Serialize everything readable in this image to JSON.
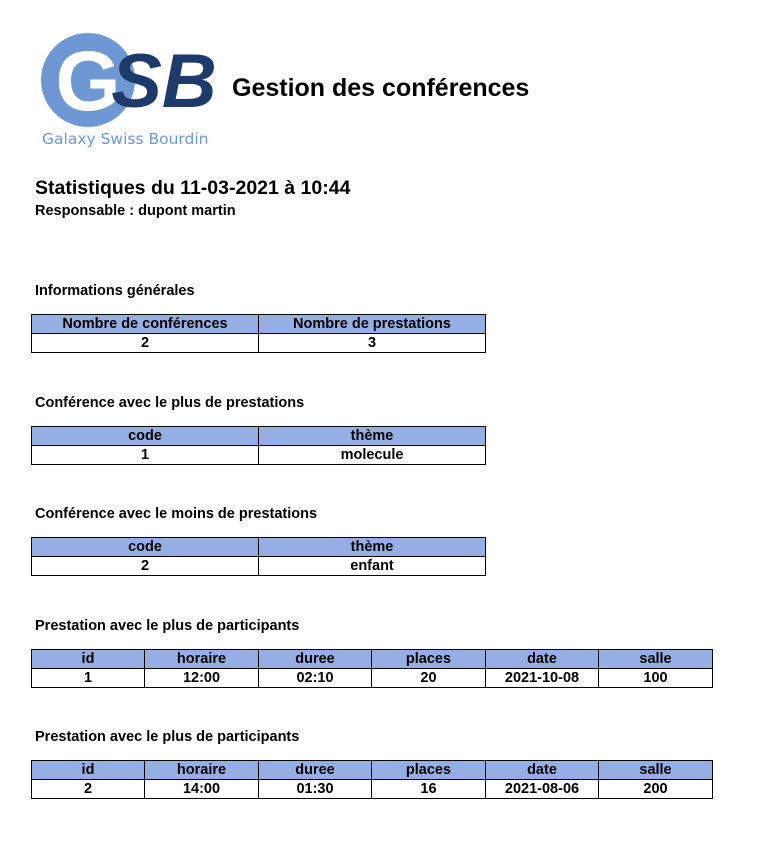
{
  "header": {
    "logo_text": "GSB",
    "logo_subtitle": "Galaxy Swiss Bourdin",
    "app_title": "Gestion des conférences"
  },
  "report": {
    "title": "Statistiques du 11-03-2021 à 10:44",
    "responsable": "Responsable : dupont martin"
  },
  "colors": {
    "header_fill": "#95aee4",
    "logo_light_blue": "#6d98d4",
    "logo_dark_blue": "#1d3a6b"
  },
  "sections": {
    "general": {
      "title": "Informations générales",
      "columns": [
        "Nombre de conférences",
        "Nombre de prestations"
      ],
      "row": [
        "2",
        "3"
      ]
    },
    "most_prestations": {
      "title": "Conférence avec le plus de prestations",
      "columns": [
        "code",
        "thème"
      ],
      "row": [
        "1",
        "molecule"
      ]
    },
    "least_prestations": {
      "title": "Conférence avec le moins de prestations",
      "columns": [
        "code",
        "thème"
      ],
      "row": [
        "2",
        "enfant"
      ]
    },
    "most_participants_1": {
      "title": "Prestation avec le plus de participants",
      "columns": [
        "id",
        "horaire",
        "duree",
        "places",
        "date",
        "salle"
      ],
      "row": [
        "1",
        "12:00",
        "02:10",
        "20",
        "2021-10-08",
        "100"
      ]
    },
    "most_participants_2": {
      "title": "Prestation avec le plus de participants",
      "columns": [
        "id",
        "horaire",
        "duree",
        "places",
        "date",
        "salle"
      ],
      "row": [
        "2",
        "14:00",
        "01:30",
        "16",
        "2021-08-06",
        "200"
      ]
    }
  }
}
